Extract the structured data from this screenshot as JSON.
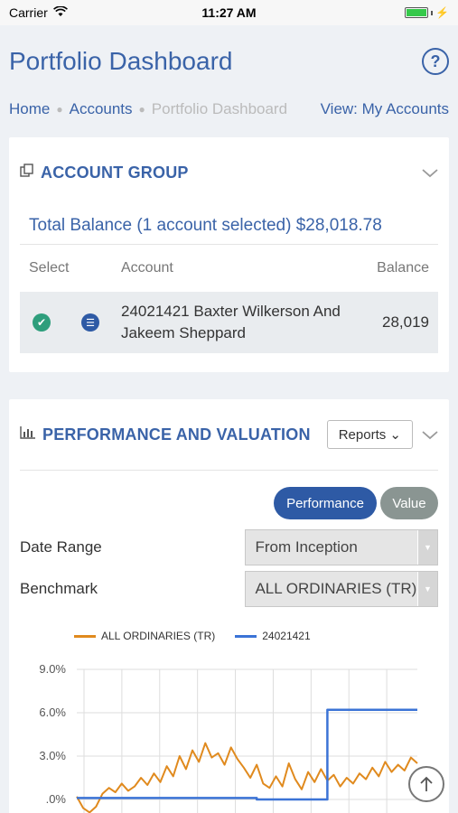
{
  "status_bar": {
    "carrier": "Carrier",
    "time": "11:27 AM"
  },
  "header": {
    "title": "Portfolio Dashboard",
    "help_label": "?"
  },
  "breadcrumb": {
    "home": "Home",
    "accounts": "Accounts",
    "current": "Portfolio Dashboard",
    "view": "View: My Accounts"
  },
  "account_group": {
    "title": "ACCOUNT GROUP",
    "total": "Total Balance (1 account selected) $28,018.78",
    "columns": {
      "select": "Select",
      "account": "Account",
      "balance": "Balance"
    },
    "rows": [
      {
        "account": "24021421  Baxter Wilkerson And Jakeem Sheppard",
        "balance": "28,019"
      }
    ]
  },
  "performance": {
    "title": "PERFORMANCE AND VALUATION",
    "reports_label": "Reports",
    "toggle": {
      "performance": "Performance",
      "value": "Value"
    },
    "date_range": {
      "label": "Date Range",
      "value": "From Inception"
    },
    "benchmark": {
      "label": "Benchmark",
      "value": "ALL ORDINARIES (TR)"
    }
  },
  "chart_data": {
    "type": "line",
    "y_ticks": [
      "9.0%",
      "6.0%",
      "3.0%",
      ".0%"
    ],
    "ylim": [
      0,
      9
    ],
    "grid": true,
    "legend_position": "top",
    "series": [
      {
        "name": "ALL ORDINARIES (TR)",
        "color": "#e08a1e",
        "values": [
          0.2,
          -0.6,
          -0.9,
          -0.5,
          0.4,
          0.8,
          0.5,
          1.1,
          0.6,
          0.9,
          1.5,
          1.0,
          1.8,
          1.2,
          2.3,
          1.6,
          3.0,
          2.1,
          3.4,
          2.6,
          3.9,
          2.9,
          3.2,
          2.4,
          3.6,
          2.8,
          2.2,
          1.5,
          2.4,
          1.1,
          0.8,
          1.6,
          0.9,
          2.5,
          1.4,
          0.7,
          1.9,
          1.2,
          2.1,
          1.3,
          1.7,
          0.9,
          1.5,
          1.1,
          1.8,
          1.4,
          2.2,
          1.6,
          2.6,
          1.9,
          2.4,
          2.0,
          2.9,
          2.5
        ]
      },
      {
        "name": "24021421",
        "color": "#3b73d6",
        "values": [
          0.1,
          0.1,
          0.1,
          0.1,
          0.1,
          0.1,
          0.1,
          0.1,
          0.1,
          0.1,
          0.1,
          0.1,
          0.1,
          0.1,
          0.1,
          0.1,
          0.1,
          0.1,
          0.1,
          0.1,
          0.1,
          0.1,
          0.1,
          0.1,
          0.1,
          0.1,
          0.1,
          0.1,
          0.0,
          0.0,
          0.0,
          0.0,
          0.0,
          0.0,
          0.0,
          0.0,
          0.0,
          0.0,
          0.0,
          6.2,
          6.2,
          6.2,
          6.2,
          6.2,
          6.2,
          6.2,
          6.2,
          6.2,
          6.2,
          6.2,
          6.2,
          6.2,
          6.2,
          6.2
        ]
      }
    ]
  }
}
